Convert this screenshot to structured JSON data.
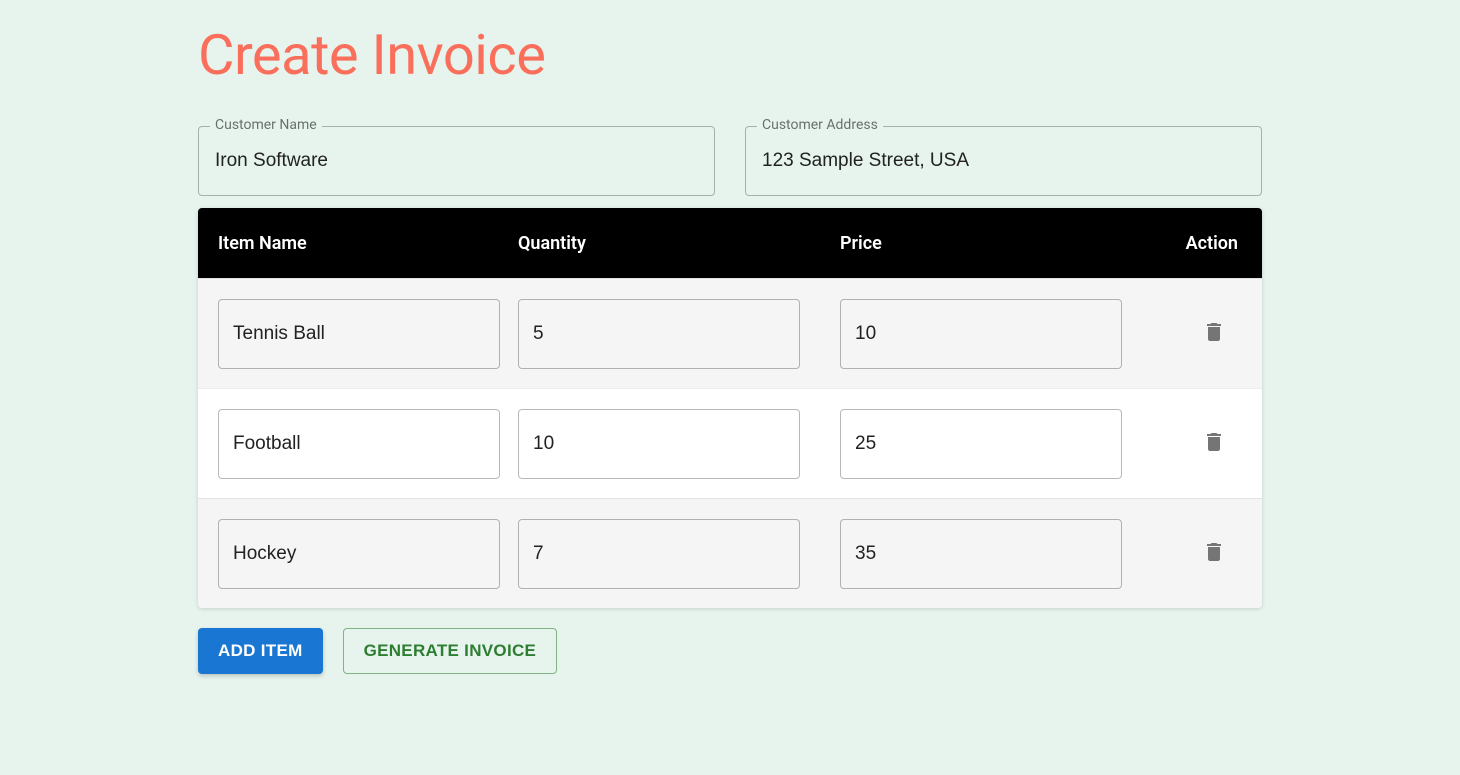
{
  "title": "Create Invoice",
  "customer": {
    "name_label": "Customer Name",
    "name_value": "Iron Software",
    "address_label": "Customer Address",
    "address_value": "123 Sample Street, USA"
  },
  "table": {
    "headers": {
      "item": "Item Name",
      "quantity": "Quantity",
      "price": "Price",
      "action": "Action"
    },
    "rows": [
      {
        "item": "Tennis Ball",
        "quantity": "5",
        "price": "10"
      },
      {
        "item": "Football",
        "quantity": "10",
        "price": "25"
      },
      {
        "item": "Hockey",
        "quantity": "7",
        "price": "35"
      }
    ]
  },
  "buttons": {
    "add_item": "Add Item",
    "generate": "Generate Invoice"
  }
}
